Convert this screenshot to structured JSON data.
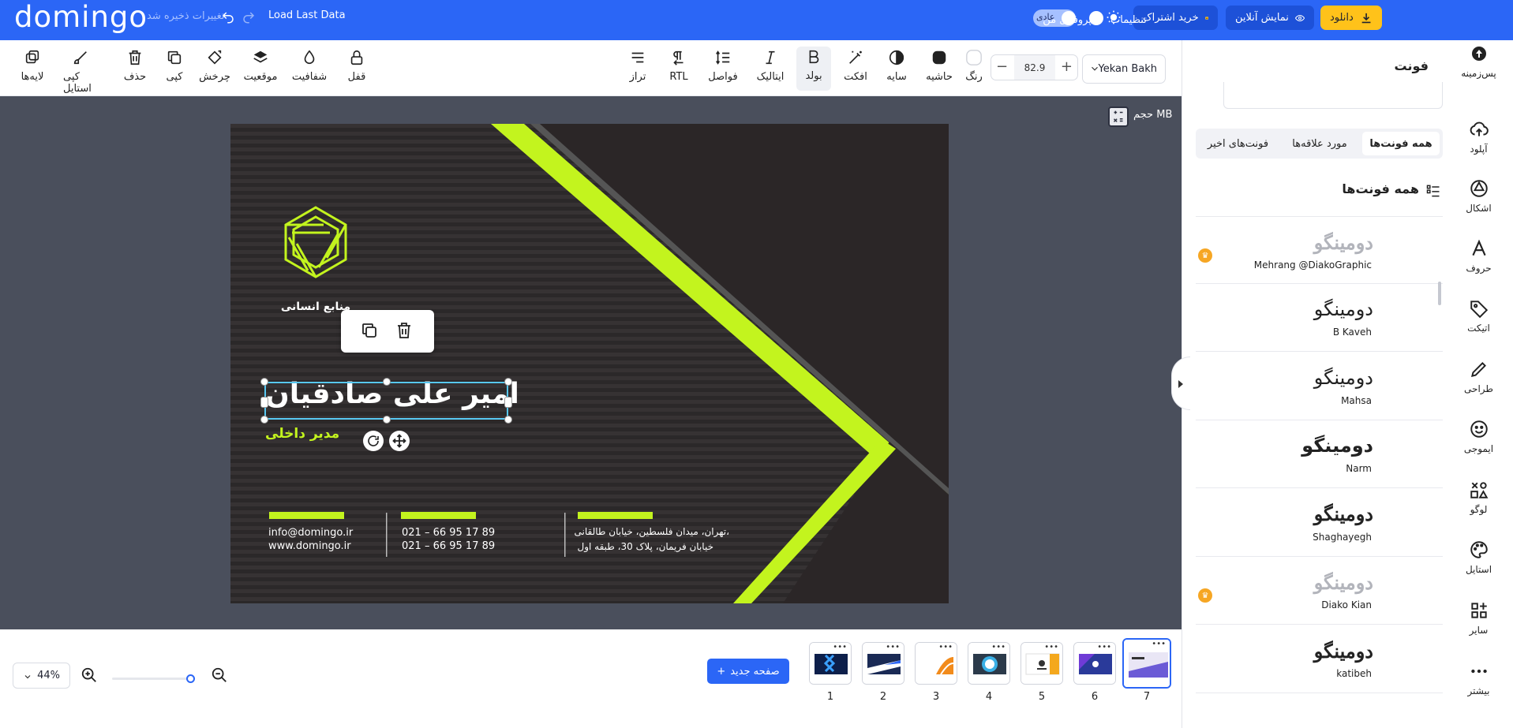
{
  "topbar": {
    "logo": "domingo",
    "saved_status": "تغییرات ذخیره شد",
    "load_last": "Load Last Data",
    "profile": "پروفایل من",
    "settings": "تنظیمات",
    "download": "دانلود",
    "preview": "نمایش آنلاین",
    "subscribe": "خرید اشتراک",
    "mode_label": "عادی"
  },
  "toolbar": {
    "font_family": "Yekan Bakh",
    "font_size": "82.9",
    "tools_right": [
      {
        "label": "رنگ",
        "icon": "color-swatch-icon"
      },
      {
        "label": "حاشیه",
        "icon": "border-icon"
      },
      {
        "label": "سایه",
        "icon": "shadow-icon"
      },
      {
        "label": "افکت",
        "icon": "magic-wand-icon"
      },
      {
        "label": "بولد",
        "icon": "bold-icon"
      },
      {
        "label": "ایتالیک",
        "icon": "italic-icon"
      },
      {
        "label": "فواصل",
        "icon": "spacing-icon"
      },
      {
        "label": "RTL",
        "icon": "rtl-icon"
      },
      {
        "label": "تراز",
        "icon": "align-icon"
      }
    ],
    "tools_left": [
      {
        "label": "قفل",
        "icon": "lock-icon"
      },
      {
        "label": "شفافیت",
        "icon": "opacity-icon"
      },
      {
        "label": "موقعیت",
        "icon": "layers-icon"
      },
      {
        "label": "چرخش",
        "icon": "rotate-icon"
      },
      {
        "label": "کپی",
        "icon": "copy-icon"
      },
      {
        "label": "حذف",
        "icon": "trash-icon"
      },
      {
        "label": "کپی استایل",
        "icon": "brush-icon"
      },
      {
        "label": "لایه‌ها",
        "icon": "layers-stack-icon"
      }
    ]
  },
  "workspace": {
    "size_label": "حجم MB"
  },
  "card": {
    "department": "منابع انسانی",
    "name": "امیر علی صادقیان",
    "role": "مدیر داخلی",
    "email": "info@domingo.ir",
    "website": "www.domingo.ir",
    "phone1": "021 – 66 95 17 89",
    "phone2": "021 – 66 95 17 89",
    "address1": "تهران، میدان فلسطین، خیابان طالقانی،",
    "address2": "خیابان فریمان، پلاک 30، طبقه اول"
  },
  "bottombar": {
    "zoom_percent": "44%",
    "new_page": "صفحه جدید",
    "pages": [
      "1",
      "2",
      "3",
      "4",
      "5",
      "6",
      "7"
    ]
  },
  "panel": {
    "title": "فونت",
    "tabs": [
      "همه فونت‌ها",
      "مورد علاقه‌ها",
      "فونت‌های اخیر"
    ],
    "section_title": "همه فونت‌ها",
    "sample_text": "دومینگو",
    "fonts": [
      {
        "name": "Mehrang @DiakoGraphic",
        "premium": true
      },
      {
        "name": "B Kaveh",
        "premium": false
      },
      {
        "name": "Mahsa",
        "premium": false
      },
      {
        "name": "Narm",
        "premium": false
      },
      {
        "name": "Shaghayegh",
        "premium": false
      },
      {
        "name": "Diako Kian",
        "premium": true
      },
      {
        "name": "katibeh",
        "premium": false
      }
    ]
  },
  "rightnav": [
    {
      "label": "پس‌زمینه",
      "icon": "background-icon"
    },
    {
      "label": "آپلود",
      "icon": "upload-icon"
    },
    {
      "label": "اشکال",
      "icon": "shapes-icon"
    },
    {
      "label": "حروف",
      "icon": "text-icon"
    },
    {
      "label": "اتیکت",
      "icon": "tag-icon"
    },
    {
      "label": "طراحی",
      "icon": "pencil-icon"
    },
    {
      "label": "ایموجی",
      "icon": "emoji-icon"
    },
    {
      "label": "لوگو",
      "icon": "logo-icon"
    },
    {
      "label": "استایل",
      "icon": "palette-icon"
    },
    {
      "label": "سایر",
      "icon": "apps-icon"
    },
    {
      "label": "بیشتر",
      "icon": "more-icon"
    }
  ],
  "colors": {
    "brand_blue": "#2b66f6",
    "accent_lime": "#c3f41e",
    "card_dark": "#2a2627",
    "download_yellow": "#ffc21a"
  }
}
